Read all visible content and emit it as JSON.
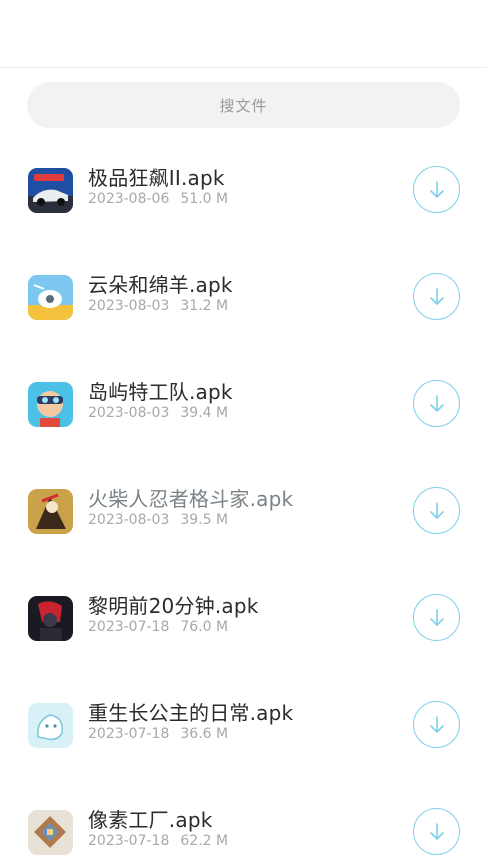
{
  "search": {
    "placeholder": "搜文件"
  },
  "files": [
    {
      "name": "极品狂飙II.apk",
      "date": "2023-08-06",
      "size": "51.0 M",
      "icon": "racing-car-app-icon",
      "dim": false
    },
    {
      "name": "云朵和绵羊.apk",
      "date": "2023-08-03",
      "size": "31.2 M",
      "icon": "cloud-sheep-app-icon",
      "dim": false
    },
    {
      "name": "岛屿特工队.apk",
      "date": "2023-08-03",
      "size": "39.4 M",
      "icon": "island-agent-app-icon",
      "dim": false
    },
    {
      "name": "火柴人忍者格斗家.apk",
      "date": "2023-08-03",
      "size": "39.5 M",
      "icon": "stickman-ninja-app-icon",
      "dim": true
    },
    {
      "name": "黎明前20分钟.apk",
      "date": "2023-07-18",
      "size": "76.0 M",
      "icon": "dawn-survivor-app-icon",
      "dim": false
    },
    {
      "name": "重生长公主的日常.apk",
      "date": "2023-07-18",
      "size": "36.6 M",
      "icon": "princess-app-icon",
      "dim": false
    },
    {
      "name": "像素工厂.apk",
      "date": "2023-07-18",
      "size": "62.2 M",
      "icon": "pixel-factory-app-icon",
      "dim": false
    }
  ],
  "colors": {
    "accent": "#7fd0ea",
    "title": "#2b2b2b",
    "meta": "#a8a8a8",
    "search_bg": "#f2f2f2"
  }
}
